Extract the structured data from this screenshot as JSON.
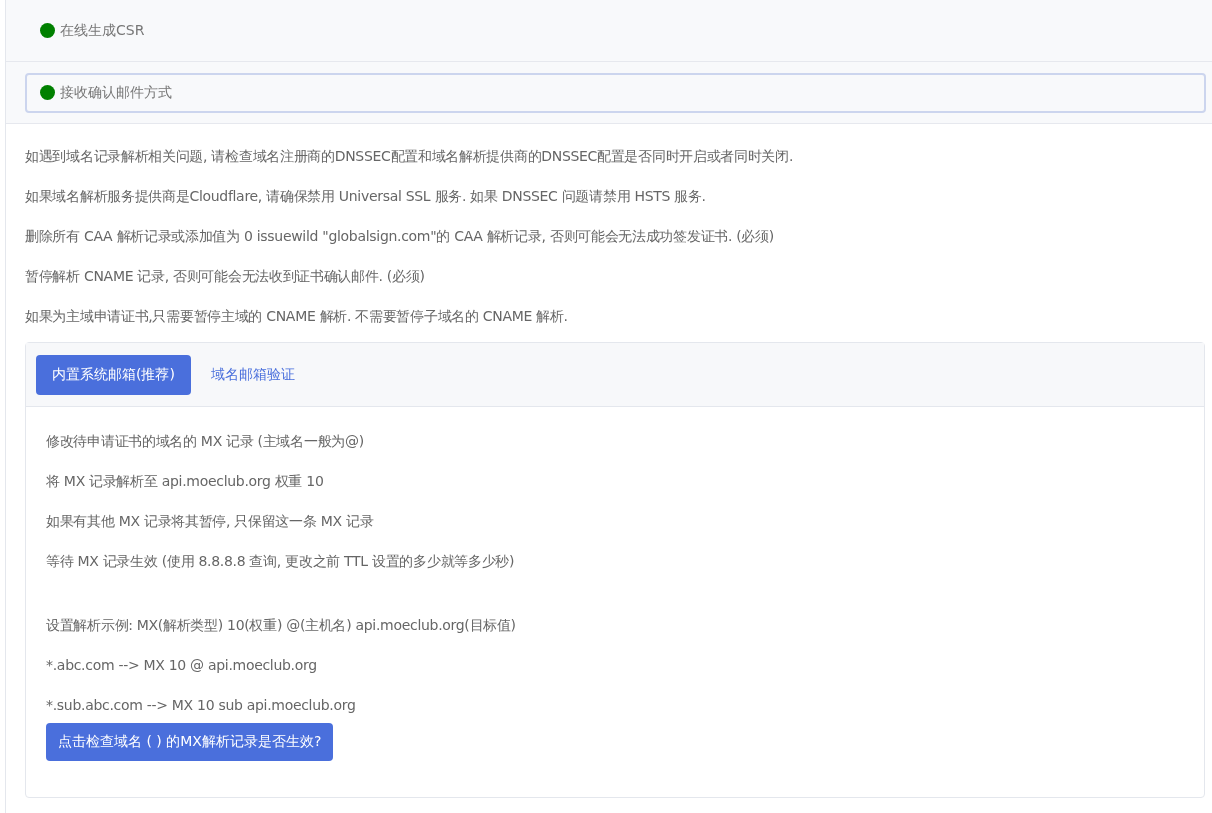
{
  "sections": [
    {
      "title": "在线生成CSR",
      "color": "#008000",
      "selected": false
    },
    {
      "title": "接收确认邮件方式",
      "color": "#008000",
      "selected": true
    }
  ],
  "notes": [
    "如遇到域名记录解析相关问题, 请检查域名注册商的DNSSEC配置和域名解析提供商的DNSSEC配置是否同时开启或者同时关闭.",
    "如果域名解析服务提供商是Cloudflare, 请确保禁用 Universal SSL 服务. 如果 DNSSEC 问题请禁用 HSTS 服务.",
    "删除所有 CAA 解析记录或添加值为 0 issuewild \"globalsign.com\"的 CAA 解析记录, 否则可能会无法成功签发证书. (必须)",
    "暂停解析 CNAME 记录, 否则可能会无法收到证书确认邮件. (必须)",
    "如果为主域申请证书,只需要暂停主域的 CNAME 解析. 不需要暂停子域名的 CNAME 解析."
  ],
  "tabs": [
    {
      "label": "内置系统邮箱(推荐)",
      "selected": true
    },
    {
      "label": "域名邮箱验证",
      "selected": false
    }
  ],
  "steps": [
    "修改待申请证书的域名的 MX 记录 (主域名一般为@)",
    "将 MX 记录解析至 api.moeclub.org 权重 10",
    "如果有其他 MX 记录将其暂停, 只保留这一条 MX 记录",
    "等待 MX 记录生效 (使用 8.8.8.8 查询, 更改之前 TTL 设置的多少就等多少秒)"
  ],
  "examples": [
    "设置解析示例: MX(解析类型) 10(权重) @(主机名) api.moeclub.org(目标值)",
    "*.abc.com --> MX 10 @ api.moeclub.org",
    "*.sub.abc.com --> MX 10 sub api.moeclub.org"
  ],
  "check_button": "点击检查域名 ( ) 的MX解析记录是否生效?"
}
